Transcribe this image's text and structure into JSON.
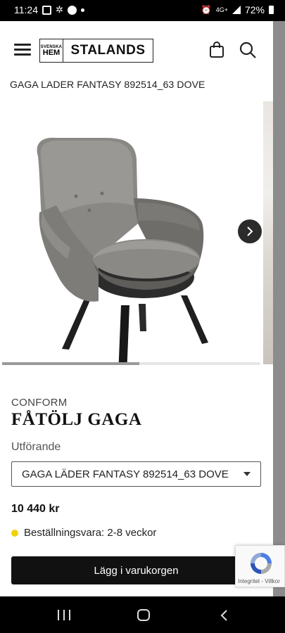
{
  "status_bar": {
    "time": "11:24",
    "battery": "72%",
    "network": "4G+"
  },
  "header": {
    "logo_small": "SVENSKA",
    "logo_hem": "HEM",
    "logo_name": "STALANDS",
    "icons": [
      "menu-icon",
      "bag-icon",
      "search-icon"
    ]
  },
  "breadcrumb": "GAGA LADER FANTASY 892514_63 DOVE",
  "gallery": {
    "image_alt": "Grey leather armchair with black wooden legs",
    "progress": 0.53
  },
  "product": {
    "brand": "CONFORM",
    "title": "FÅTÖLJ GAGA",
    "variant_label": "Utförande",
    "variant_selected": "GAGA LÄDER FANTASY 892514_63 DOVE",
    "price": "10 440 kr",
    "availability": "Beställningsvara: 2-8 veckor",
    "availability_color": "#f2d20b",
    "add_to_cart": "Lägg i varukorgen"
  },
  "recaptcha": {
    "links": "Integritet - Villkor"
  }
}
